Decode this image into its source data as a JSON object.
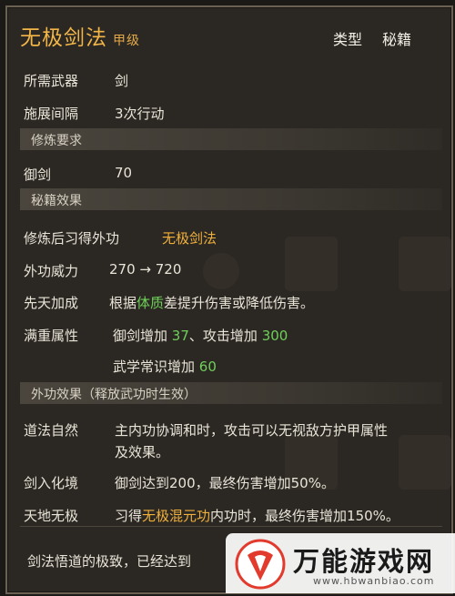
{
  "skill": {
    "name": "无极剑法",
    "grade": "甲级",
    "type_label": "类型",
    "type_value": "秘籍"
  },
  "basic": [
    {
      "label": "所需武器",
      "value": "剑"
    },
    {
      "label": "施展间隔",
      "value": "3次行动"
    }
  ],
  "requirements": {
    "header": "修炼要求",
    "items": [
      {
        "label": "御剑",
        "value": "70"
      }
    ]
  },
  "effects": {
    "header": "秘籍效果",
    "learn_label": "修炼后习得外功",
    "learn_value": "无极剑法",
    "power_label": "外功威力",
    "power_value": "270 → 720",
    "innate_label": "先天加成",
    "innate_pre": "根据",
    "innate_highlight": "体质",
    "innate_post": "差提升伤害或降低伤害。",
    "max_label": "满重属性",
    "max_line1_a": "御剑增加",
    "max_line1_a_val": "37",
    "max_line1_b": "、攻击增加",
    "max_line1_b_val": "300",
    "max_line2_a": "武学常识增加",
    "max_line2_a_val": "60"
  },
  "external": {
    "header": "外功效果（释放武功时生效）",
    "items": [
      {
        "label": "道法自然",
        "line1": "主内功协调和时，攻击可以无视敌方护甲属性",
        "line2": "及效果。"
      },
      {
        "label": "剑入化境",
        "line1": "御剑达到200，最终伤害增加50%。"
      },
      {
        "label": "天地无极",
        "pre": "习得",
        "highlight": "无极混元功",
        "post": "内功时，最终伤害增加150%。"
      }
    ]
  },
  "footer": {
    "text": "剑法悟道的极致，已经达到"
  },
  "watermark": {
    "name": "万能游戏网",
    "url": "www.hbwanbiao.com"
  }
}
